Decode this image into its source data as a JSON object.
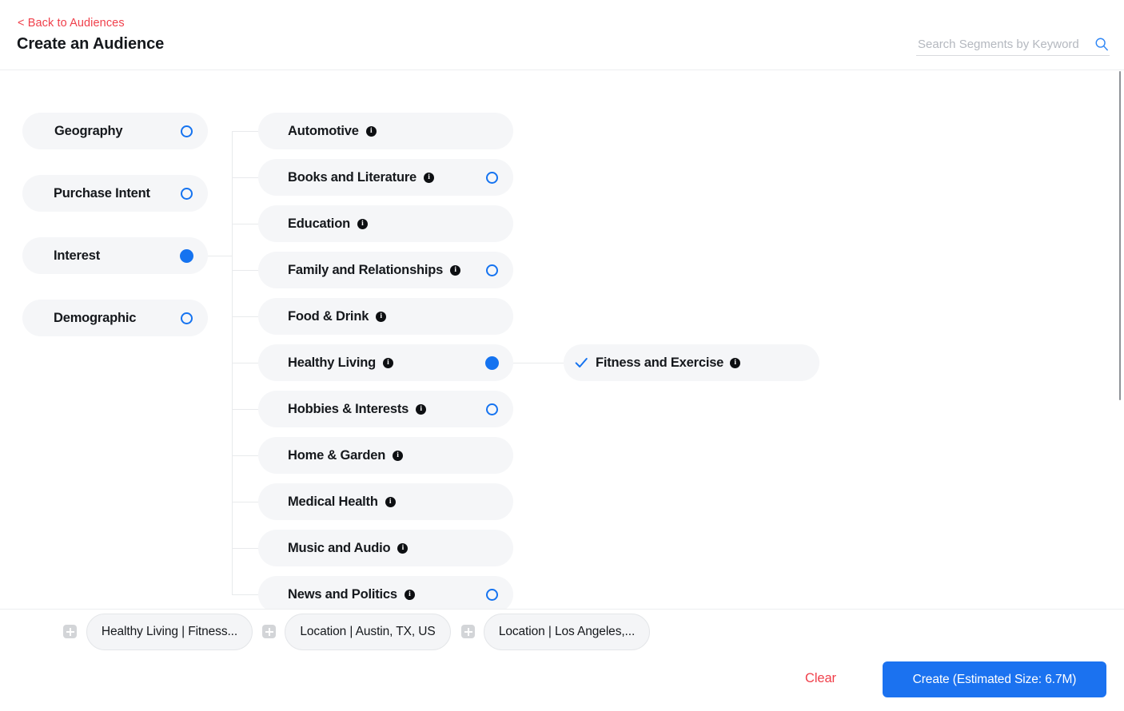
{
  "header": {
    "back_link": "< Back to Audiences",
    "title": "Create an Audience",
    "search": {
      "placeholder": "Search Segments by Keyword",
      "value": "",
      "icon": "search-icon"
    }
  },
  "tree": {
    "column1": {
      "items": [
        {
          "label": "Geography",
          "state": "unselected",
          "indicator": "ring"
        },
        {
          "label": "Purchase Intent",
          "state": "unselected",
          "indicator": "ring"
        },
        {
          "label": "Interest",
          "state": "selected",
          "indicator": "dot"
        },
        {
          "label": "Demographic",
          "state": "unselected",
          "indicator": "ring"
        }
      ]
    },
    "column2": {
      "items": [
        {
          "label": "Automotive",
          "info": "i",
          "indicator": "none"
        },
        {
          "label": "Books and Literature",
          "info": "i",
          "indicator": "ring"
        },
        {
          "label": "Education",
          "info": "i",
          "indicator": "none"
        },
        {
          "label": "Family and Relationships",
          "info": "i",
          "indicator": "ring"
        },
        {
          "label": "Food & Drink",
          "info": "i",
          "indicator": "none"
        },
        {
          "label": "Healthy Living",
          "info": "i",
          "indicator": "dot"
        },
        {
          "label": "Hobbies & Interests",
          "info": "i",
          "indicator": "ring"
        },
        {
          "label": "Home & Garden",
          "info": "i",
          "indicator": "none"
        },
        {
          "label": "Medical Health",
          "info": "i",
          "indicator": "none"
        },
        {
          "label": "Music and Audio",
          "info": "i",
          "indicator": "none"
        },
        {
          "label": "News and Politics",
          "info": "i",
          "indicator": "ring"
        }
      ]
    },
    "column3": {
      "items": [
        {
          "label": "Fitness and Exercise",
          "info": "i",
          "indicator": "check"
        }
      ]
    }
  },
  "chips": {
    "items": [
      {
        "add_icon": "plus-icon",
        "label": "Healthy Living | Fitness..."
      },
      {
        "add_icon": "plus-icon",
        "label": "Location | Austin, TX, US"
      },
      {
        "add_icon": "plus-icon",
        "label": "Location | Los Angeles,..."
      }
    ]
  },
  "actions": {
    "clear_label": "Clear",
    "create_label": "Create (Estimated Size: 6.7M)"
  },
  "colors": {
    "accent_blue": "#1573f0",
    "create_blue": "#1b72f0",
    "link_red": "#f0404b",
    "pill_bg": "#f5f6f8"
  }
}
